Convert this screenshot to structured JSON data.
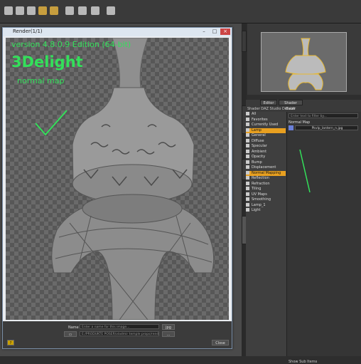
{
  "render_window": {
    "title": "Render(1/1)",
    "overlay": {
      "version": "version 4.8.0.9 Edition (64-bit)",
      "engine": "3Delight",
      "note": "normal map"
    },
    "name_label": "Name",
    "name_placeholder": "Enter a name for this image...",
    "format": "jpg",
    "path": "E:/PRODUKTE POSER/vladmir temple props/renders",
    "close_label": "Close",
    "help_label": "?"
  },
  "right_panel": {
    "tabs": [
      "Editor",
      "Shader Baker"
    ],
    "header": "Shader  DAZ Studio Default",
    "filter_placeholder": "Enter text to filter by...",
    "property_label": "Normal Map",
    "texture_file": "Pkvlp_lantern_n.jpg",
    "tree": [
      {
        "label": "All",
        "selected": false
      },
      {
        "label": "Favorites",
        "selected": false
      },
      {
        "label": "Currently Used",
        "selected": false
      },
      {
        "label": "Lamp",
        "selected": true
      },
      {
        "label": "General",
        "selected": false
      },
      {
        "label": "Diffuse",
        "selected": false
      },
      {
        "label": "Specular",
        "selected": false
      },
      {
        "label": "Ambient",
        "selected": false
      },
      {
        "label": "Opacity",
        "selected": false
      },
      {
        "label": "Bump",
        "selected": false
      },
      {
        "label": "Displacement",
        "selected": false
      },
      {
        "label": "Normal Mapping",
        "selected": true
      },
      {
        "label": "Reflection",
        "selected": false
      },
      {
        "label": "Refraction",
        "selected": false
      },
      {
        "label": "Tiling",
        "selected": false
      },
      {
        "label": "UV Maps",
        "selected": false
      },
      {
        "label": "Smoothing",
        "selected": false
      },
      {
        "label": "Lamp_1",
        "selected": false
      },
      {
        "label": "Light",
        "selected": false
      }
    ],
    "footer": "Show Sub Items"
  },
  "colors": {
    "overlay_green": "#33e05a",
    "selection_orange": "#e8a020"
  }
}
